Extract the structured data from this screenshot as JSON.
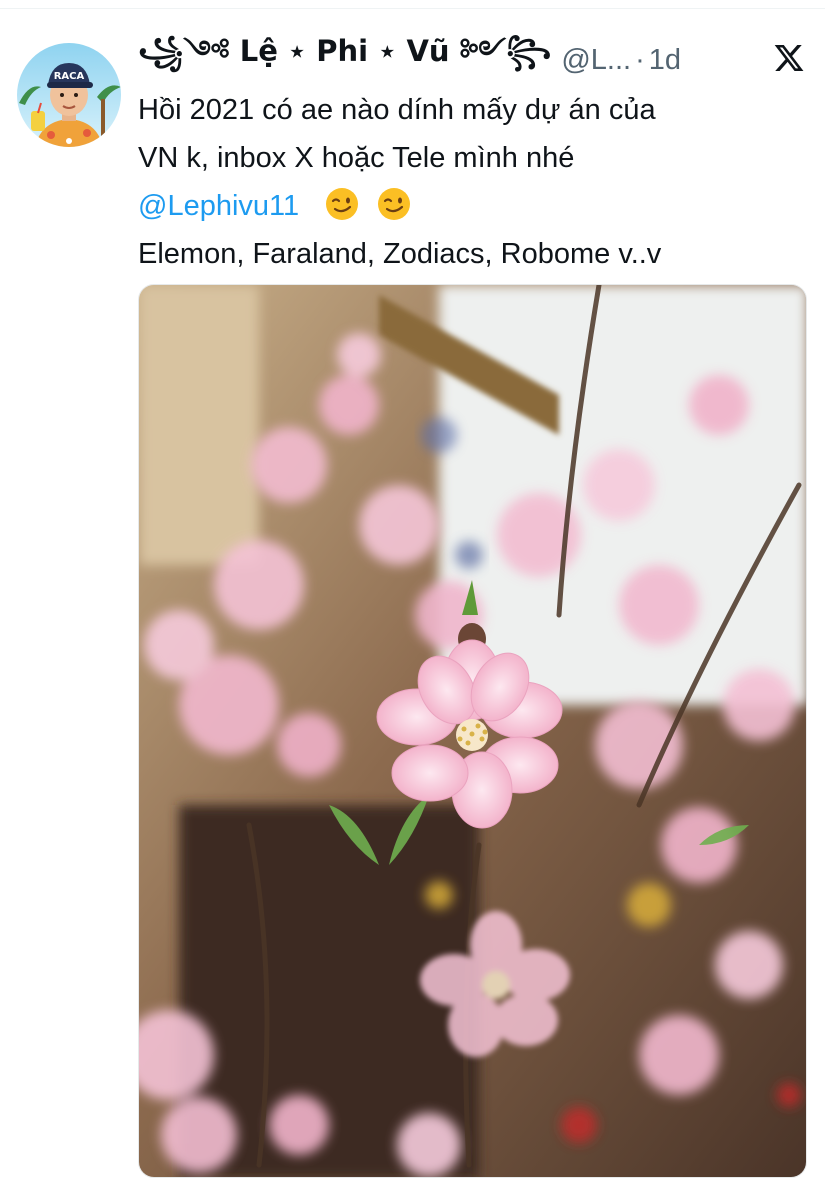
{
  "tweet": {
    "display_name": "꧁༺ Lệ ⋆ Phi ⋆ Vũ ༻꧂",
    "handle": "@L...",
    "dot": "·",
    "time": "1d",
    "text_lines": [
      "Hồi 2021 có ae nào dính mấy dự án của",
      "VN k, inbox X hoặc Tele mình nhé"
    ],
    "mention": "@Lephivu11",
    "last_line": "Elemon, Faraland, Zodiacs, Robome v..v"
  },
  "avatar": {
    "cap_text": "RACA"
  },
  "icons": {
    "logo": "x-logo-icon",
    "emoji": "winking-face-icon"
  },
  "colors": {
    "text": "#0f1419",
    "secondary": "#536471",
    "link": "#1d9bf0",
    "blossom": "#f4bfd3"
  }
}
